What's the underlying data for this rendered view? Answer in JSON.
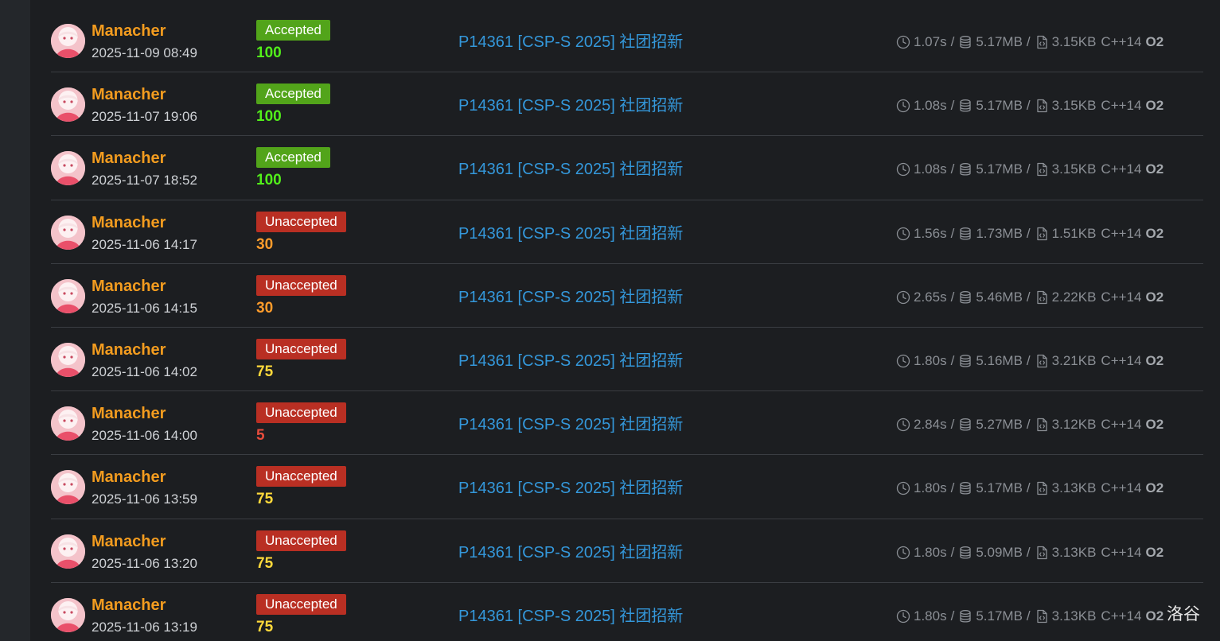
{
  "colors": {
    "username": "#f39c1f",
    "accepted_badge": "#52a41a",
    "unaccepted_badge": "#b92f23",
    "problem_link": "#3498db",
    "meta_text": "#8b8f95",
    "score_full": "#52ee1a",
    "score_mid": "#ffd93b",
    "score_low": "#ff9c2b",
    "score_very_low": "#e74c3c"
  },
  "records": [
    {
      "user": "Manacher",
      "time": "2025-11-09 08:49",
      "status": "Accepted",
      "score": "100",
      "problem": "P14361 [CSP-S 2025] 社团招新",
      "runtime": "1.07s",
      "memory": "5.17MB",
      "code_size": "3.15KB",
      "language": "C++14",
      "optimization": "O2"
    },
    {
      "user": "Manacher",
      "time": "2025-11-07 19:06",
      "status": "Accepted",
      "score": "100",
      "problem": "P14361 [CSP-S 2025] 社团招新",
      "runtime": "1.08s",
      "memory": "5.17MB",
      "code_size": "3.15KB",
      "language": "C++14",
      "optimization": "O2"
    },
    {
      "user": "Manacher",
      "time": "2025-11-07 18:52",
      "status": "Accepted",
      "score": "100",
      "problem": "P14361 [CSP-S 2025] 社团招新",
      "runtime": "1.08s",
      "memory": "5.17MB",
      "code_size": "3.15KB",
      "language": "C++14",
      "optimization": "O2"
    },
    {
      "user": "Manacher",
      "time": "2025-11-06 14:17",
      "status": "Unaccepted",
      "score": "30",
      "problem": "P14361 [CSP-S 2025] 社团招新",
      "runtime": "1.56s",
      "memory": "1.73MB",
      "code_size": "1.51KB",
      "language": "C++14",
      "optimization": "O2"
    },
    {
      "user": "Manacher",
      "time": "2025-11-06 14:15",
      "status": "Unaccepted",
      "score": "30",
      "problem": "P14361 [CSP-S 2025] 社团招新",
      "runtime": "2.65s",
      "memory": "5.46MB",
      "code_size": "2.22KB",
      "language": "C++14",
      "optimization": "O2"
    },
    {
      "user": "Manacher",
      "time": "2025-11-06 14:02",
      "status": "Unaccepted",
      "score": "75",
      "problem": "P14361 [CSP-S 2025] 社团招新",
      "runtime": "1.80s",
      "memory": "5.16MB",
      "code_size": "3.21KB",
      "language": "C++14",
      "optimization": "O2"
    },
    {
      "user": "Manacher",
      "time": "2025-11-06 14:00",
      "status": "Unaccepted",
      "score": "5",
      "problem": "P14361 [CSP-S 2025] 社团招新",
      "runtime": "2.84s",
      "memory": "5.27MB",
      "code_size": "3.12KB",
      "language": "C++14",
      "optimization": "O2"
    },
    {
      "user": "Manacher",
      "time": "2025-11-06 13:59",
      "status": "Unaccepted",
      "score": "75",
      "problem": "P14361 [CSP-S 2025] 社团招新",
      "runtime": "1.80s",
      "memory": "5.17MB",
      "code_size": "3.13KB",
      "language": "C++14",
      "optimization": "O2"
    },
    {
      "user": "Manacher",
      "time": "2025-11-06 13:20",
      "status": "Unaccepted",
      "score": "75",
      "problem": "P14361 [CSP-S 2025] 社团招新",
      "runtime": "1.80s",
      "memory": "5.09MB",
      "code_size": "3.13KB",
      "language": "C++14",
      "optimization": "O2"
    },
    {
      "user": "Manacher",
      "time": "2025-11-06 13:19",
      "status": "Unaccepted",
      "score": "75",
      "problem": "P14361 [CSP-S 2025] 社团招新",
      "runtime": "1.80s",
      "memory": "5.17MB",
      "code_size": "3.13KB",
      "language": "C++14",
      "optimization": "O2"
    }
  ],
  "brand": "洛谷"
}
